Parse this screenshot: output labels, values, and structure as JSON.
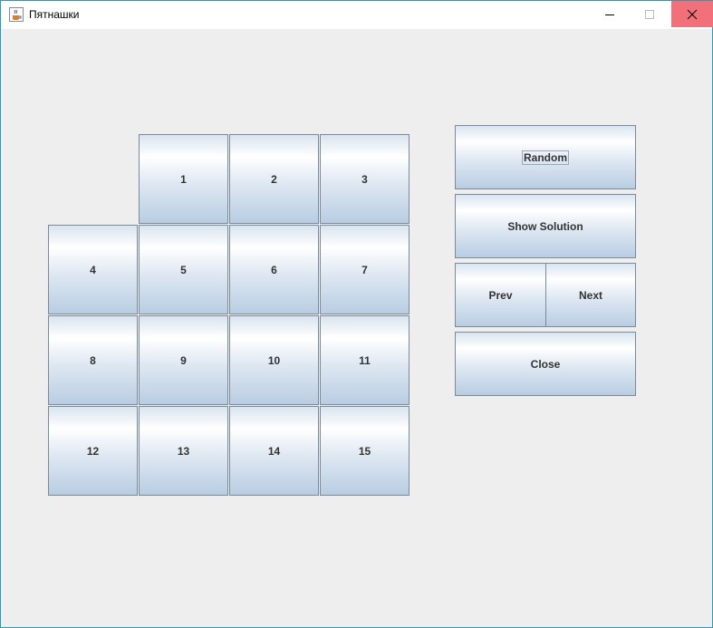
{
  "window": {
    "title": "Пятнашки",
    "icons": {
      "app": "java-cup-icon",
      "minimize": "minimize-icon",
      "maximize": "maximize-icon",
      "close": "close-icon"
    },
    "colors": {
      "close_hover": "#f1707a",
      "border": "#2a9bb4"
    }
  },
  "board": {
    "tiles": [
      {
        "label": ""
      },
      {
        "label": "1"
      },
      {
        "label": "2"
      },
      {
        "label": "3"
      },
      {
        "label": "4"
      },
      {
        "label": "5"
      },
      {
        "label": "6"
      },
      {
        "label": "7"
      },
      {
        "label": "8"
      },
      {
        "label": "9"
      },
      {
        "label": "10"
      },
      {
        "label": "11"
      },
      {
        "label": "12"
      },
      {
        "label": "13"
      },
      {
        "label": "14"
      },
      {
        "label": "15"
      }
    ]
  },
  "controls": {
    "random": "Random",
    "show_solution": "Show Solution",
    "prev": "Prev",
    "next": "Next",
    "close": "Close"
  }
}
